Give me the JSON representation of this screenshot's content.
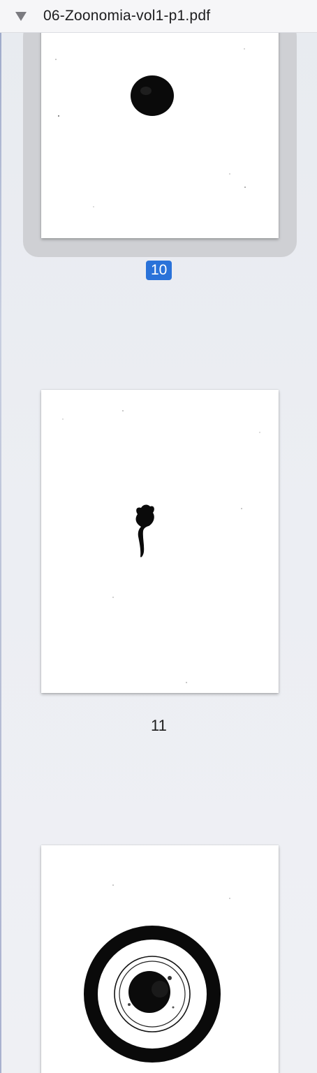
{
  "sidebar": {
    "document": {
      "title": "06-Zoonomia-vol1-p1.pdf",
      "disclosure_icon": "triangle-down-icon"
    },
    "pages": [
      {
        "label": "10",
        "selected": true
      },
      {
        "label": "11",
        "selected": false
      },
      {
        "label": "",
        "selected": false
      }
    ]
  },
  "colors": {
    "selection_badge": "#2a72d9",
    "selection_frame": "#cfd0d4",
    "sidebar_bg": "#eceef2"
  }
}
